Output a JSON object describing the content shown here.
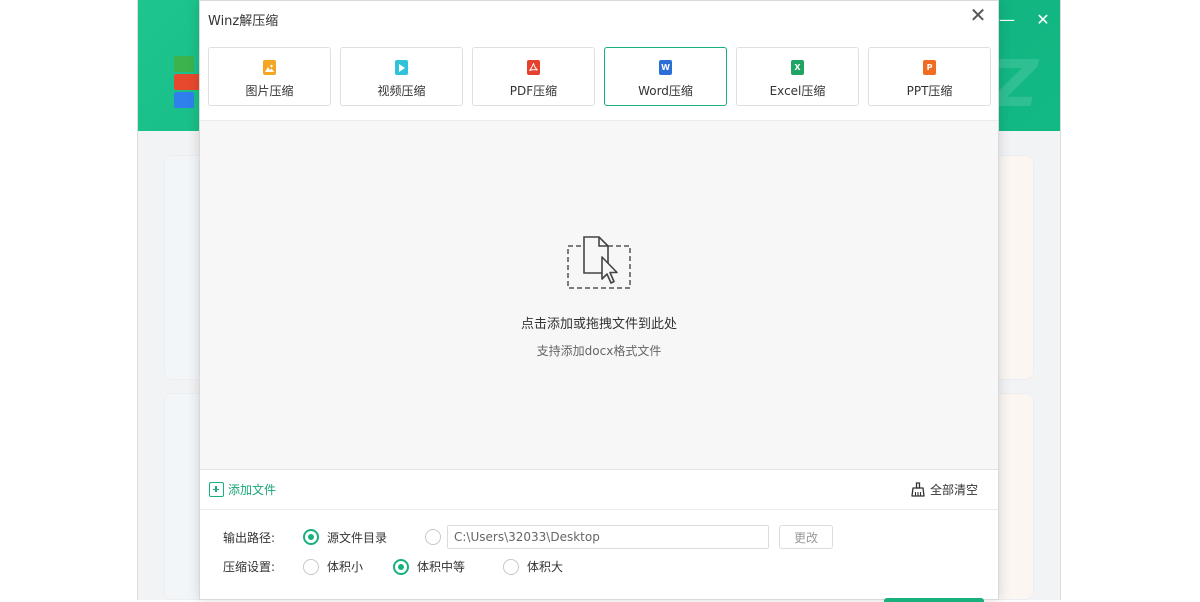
{
  "dialog": {
    "title": "Winz解压缩",
    "close_glyph": "✕"
  },
  "tabs": [
    {
      "label": "图片压缩",
      "icon": "image-icon",
      "color": "#f5a623"
    },
    {
      "label": "视频压缩",
      "icon": "video-icon",
      "color": "#2ec3d9"
    },
    {
      "label": "PDF压缩",
      "icon": "pdf-icon",
      "color": "#e5412d"
    },
    {
      "label": "Word压缩",
      "icon": "word-icon",
      "color": "#2b6fd6",
      "active": true
    },
    {
      "label": "Excel压缩",
      "icon": "excel-icon",
      "color": "#1fa463"
    },
    {
      "label": "PPT压缩",
      "icon": "ppt-icon",
      "color": "#f26b21"
    }
  ],
  "drop_area": {
    "main_text": "点击添加或拖拽文件到此处",
    "sub_text": "支持添加docx格式文件"
  },
  "toolbar": {
    "add_file_label": "添加文件",
    "clear_all_label": "全部清空"
  },
  "output": {
    "label": "输出路径:",
    "option_source": "源文件目录",
    "path_value": "C:\\Users\\32033\\Desktop",
    "change_label": "更改",
    "selected": "source"
  },
  "compression": {
    "label": "压缩设置:",
    "options": [
      "体积小",
      "体积中等",
      "体积大"
    ],
    "selected": "体积中等"
  },
  "colors": {
    "accent": "#18b07c",
    "header_green": "#13b985"
  },
  "background_window": {
    "controls": [
      "—",
      "✕"
    ]
  }
}
